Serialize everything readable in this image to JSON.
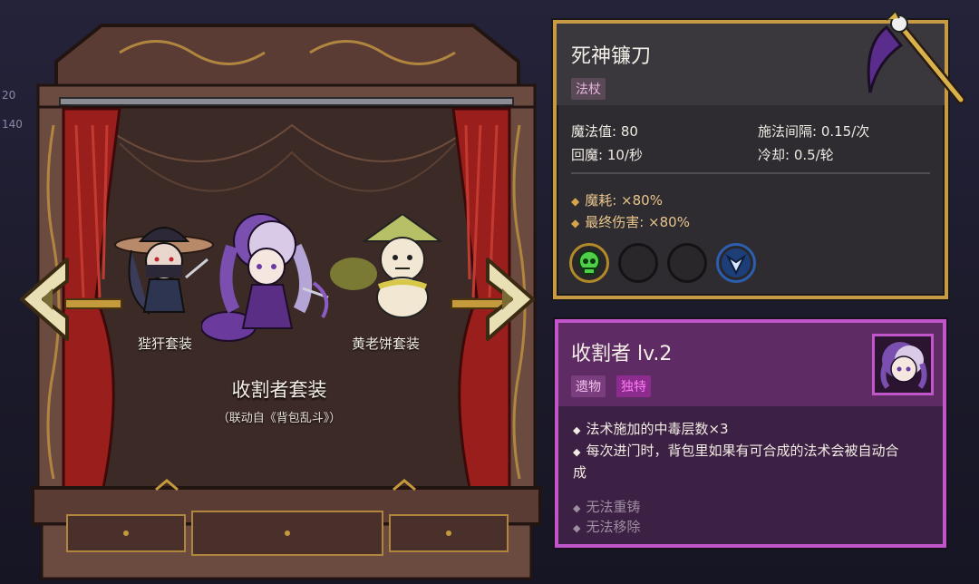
{
  "background": {
    "side_numbers": [
      "20",
      "140"
    ]
  },
  "wardrobe": {
    "costumes": {
      "left": "狴犴套装",
      "right": "黄老饼套装"
    },
    "set_title": "收割者套装",
    "set_subtitle": "（联动自《背包乱斗》）",
    "nav": {
      "prev_icon": "chevron-left-icon",
      "next_icon": "chevron-right-icon"
    }
  },
  "item": {
    "name": "死神镰刀",
    "type": "法杖",
    "stats": {
      "mana": "魔法值: 80",
      "cast_interval": "施法间隔: 0.15/次",
      "mana_regen": "回魔: 10/秒",
      "cooldown": "冷却: 0.5/轮"
    },
    "modifiers": [
      "魔耗: ×80%",
      "最终伤害: ×80%"
    ],
    "slots": [
      {
        "icon": "green-skull-icon",
        "filled": true
      },
      {
        "icon": "empty-slot",
        "filled": false
      },
      {
        "icon": "empty-slot",
        "filled": false
      },
      {
        "icon": "blue-crystal-icon",
        "filled": true
      }
    ]
  },
  "relic": {
    "name": "收割者 lv.2",
    "tags": [
      "遗物",
      "独特"
    ],
    "effects": [
      "法术施加的中毒层数×3",
      "每次进门时，背包里如果有可合成的法术会被自动合成"
    ],
    "notes": [
      "无法重铸",
      "无法移除"
    ]
  },
  "colors": {
    "item_border": "#c79a45",
    "relic_border": "#c056c9",
    "relic_unique_tag": "#ff7cf4",
    "modifier_text": "#e8c58c"
  }
}
